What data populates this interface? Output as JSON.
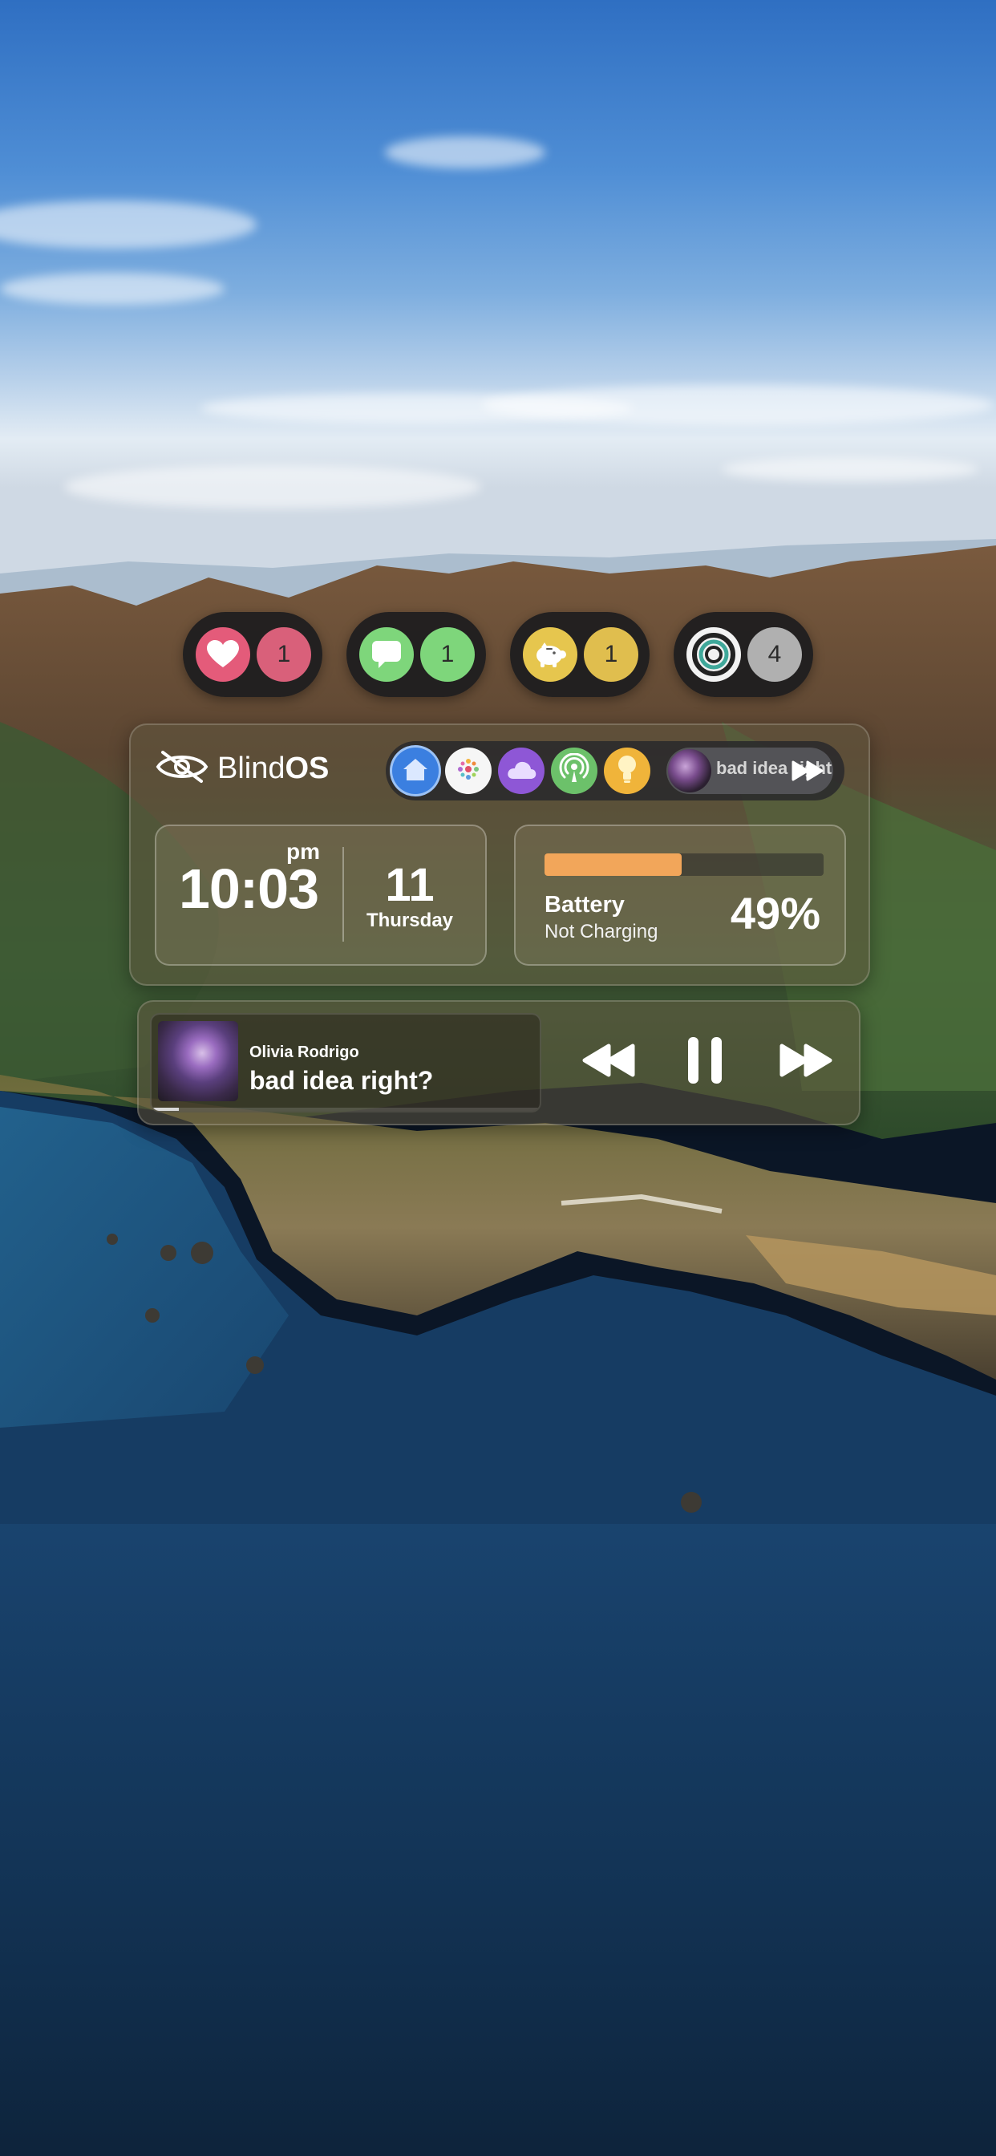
{
  "wallpaper": {
    "sky_color": "#4f8ed5",
    "sea_color": "#163c63"
  },
  "badges": [
    {
      "icon": "heart-icon",
      "count": "1",
      "color": "#e45b7a"
    },
    {
      "icon": "message-icon",
      "count": "1",
      "color": "#7ed67b"
    },
    {
      "icon": "piggy-bank-icon",
      "count": "1",
      "color": "#e6c64e"
    },
    {
      "icon": "activity-rings-icon",
      "count": "4",
      "color": "#b0b0b0"
    }
  ],
  "brand": {
    "name_regular": "Blind",
    "name_bold": "OS",
    "icon": "eye-slash-icon"
  },
  "dock": {
    "apps": [
      "home-icon",
      "photos-icon",
      "weather-icon",
      "podcasts-icon",
      "tips-icon"
    ],
    "now_playing_text": "bad idea right?"
  },
  "clock": {
    "time": "10:03",
    "ampm": "pm",
    "day": "11",
    "weekday": "Thursday"
  },
  "battery": {
    "label": "Battery",
    "status": "Not Charging",
    "percent_text": "49%",
    "level": 0.49,
    "color": "#f2a65a"
  },
  "music": {
    "artist": "Olivia Rodrigo",
    "title": "bad idea right?",
    "progress": 0.07,
    "controls": [
      "rewind-icon",
      "pause-icon",
      "fast-forward-icon"
    ]
  }
}
